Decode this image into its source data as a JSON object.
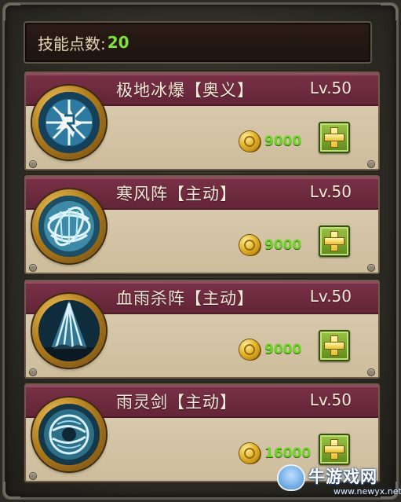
{
  "skill_points": {
    "label": "技能点数:",
    "value": "20"
  },
  "skills": [
    {
      "name": "极地冰爆【奥义】",
      "level": "Lv.50",
      "cost": "9000",
      "icon": "ice-explosion-icon"
    },
    {
      "name": "寒风阵【主动】",
      "level": "Lv.50",
      "cost": "9000",
      "icon": "cold-wind-formation-icon"
    },
    {
      "name": "血雨杀阵【主动】",
      "level": "Lv.50",
      "cost": "9000",
      "icon": "blood-rain-formation-icon"
    },
    {
      "name": "雨灵剑【主动】",
      "level": "Lv.50",
      "cost": "16000",
      "icon": "rain-spirit-sword-icon"
    }
  ],
  "colors": {
    "points_value": "#7ee33c",
    "cost_value": "#6fd42a",
    "header": "#6e2a3f",
    "card_body": "#d6c6a8",
    "plus_button": "#7aa830"
  },
  "watermark": {
    "title": "牛游戏网",
    "url": "www.newyx.net"
  }
}
